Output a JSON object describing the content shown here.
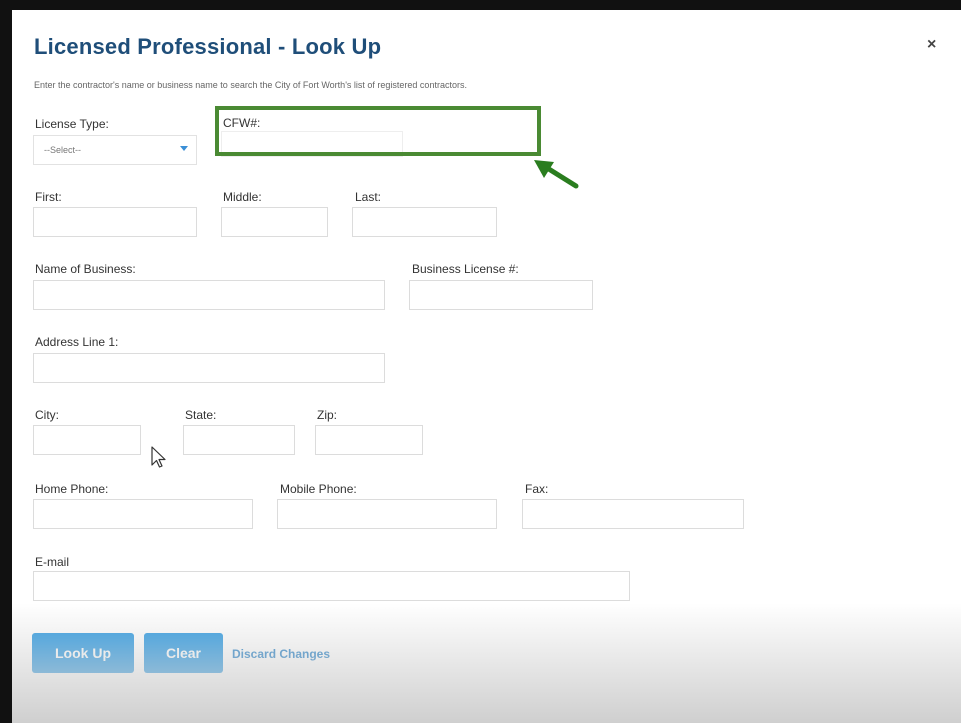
{
  "dialog": {
    "title": "Licensed Professional - Look Up",
    "close_symbol": "×",
    "subtitle": "Enter the contractor's name or business name to search the City of Fort Worth's list of registered contractors."
  },
  "fields": {
    "license_type": {
      "label": "License Type:",
      "value": "--Select--"
    },
    "cfw": {
      "label": "CFW#:",
      "value": ""
    },
    "first": {
      "label": "First:",
      "value": ""
    },
    "middle": {
      "label": "Middle:",
      "value": ""
    },
    "last": {
      "label": "Last:",
      "value": ""
    },
    "business_name": {
      "label": "Name of Business:",
      "value": ""
    },
    "business_license": {
      "label": "Business License #:",
      "value": ""
    },
    "address1": {
      "label": "Address Line 1:",
      "value": ""
    },
    "city": {
      "label": "City:",
      "value": ""
    },
    "state": {
      "label": "State:",
      "value": ""
    },
    "zip": {
      "label": "Zip:",
      "value": ""
    },
    "home_phone": {
      "label": "Home Phone:",
      "value": ""
    },
    "mobile_phone": {
      "label": "Mobile Phone:",
      "value": ""
    },
    "fax": {
      "label": "Fax:",
      "value": ""
    },
    "email": {
      "label": "E-mail",
      "value": ""
    }
  },
  "actions": {
    "lookup": "Look Up",
    "clear": "Clear",
    "discard": "Discard Changes"
  },
  "colors": {
    "title": "#1f4e79",
    "button": "#2f9be2",
    "highlight": "#4a8a33",
    "link": "#2f86c9"
  },
  "annotations": {
    "highlight_box": "green-highlight-box",
    "arrow": "green-arrow-icon"
  }
}
